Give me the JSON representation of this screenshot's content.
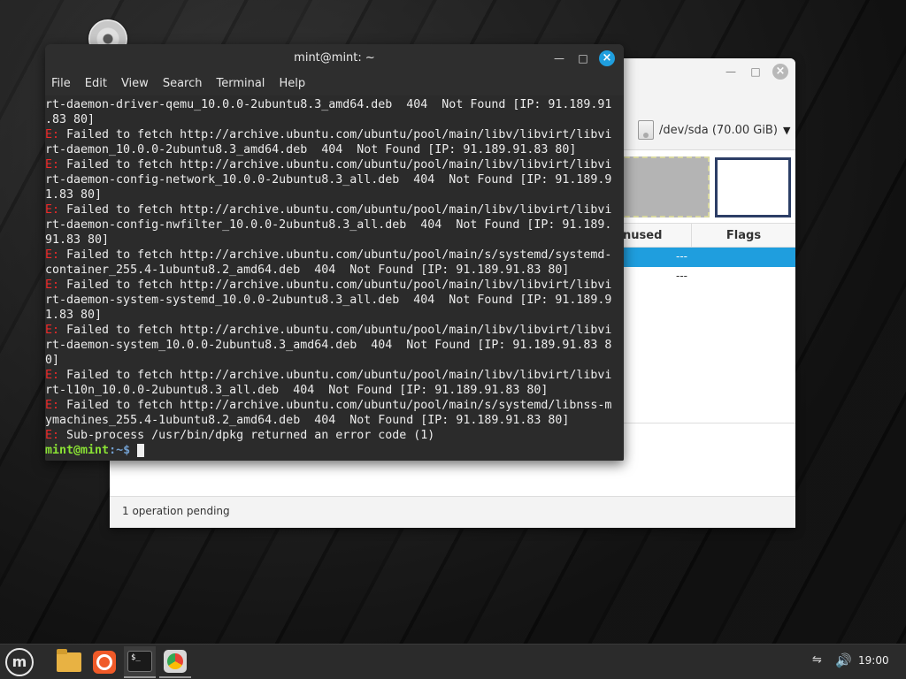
{
  "gparted": {
    "device_label": "/dev/sda (70.00 GiB)",
    "columns": {
      "unused": "nused",
      "flags": "Flags"
    },
    "rows": [
      "---",
      "---"
    ],
    "status": "1 operation pending"
  },
  "terminal": {
    "title": "mint@mint: ~",
    "menu": [
      "File",
      "Edit",
      "View",
      "Search",
      "Terminal",
      "Help"
    ],
    "lines": [
      {
        "type": "plain",
        "text": "rt-daemon-driver-qemu_10.0.0-2ubuntu8.3_amd64.deb  404  Not Found [IP: 91.189.91"
      },
      {
        "type": "plain",
        "text": ".83 80]"
      },
      {
        "type": "err",
        "text": " Failed to fetch http://archive.ubuntu.com/ubuntu/pool/main/libv/libvirt/libvi"
      },
      {
        "type": "plain",
        "text": "rt-daemon_10.0.0-2ubuntu8.3_amd64.deb  404  Not Found [IP: 91.189.91.83 80]"
      },
      {
        "type": "err",
        "text": " Failed to fetch http://archive.ubuntu.com/ubuntu/pool/main/libv/libvirt/libvi"
      },
      {
        "type": "plain",
        "text": "rt-daemon-config-network_10.0.0-2ubuntu8.3_all.deb  404  Not Found [IP: 91.189.9"
      },
      {
        "type": "plain",
        "text": "1.83 80]"
      },
      {
        "type": "err",
        "text": " Failed to fetch http://archive.ubuntu.com/ubuntu/pool/main/libv/libvirt/libvi"
      },
      {
        "type": "plain",
        "text": "rt-daemon-config-nwfilter_10.0.0-2ubuntu8.3_all.deb  404  Not Found [IP: 91.189."
      },
      {
        "type": "plain",
        "text": "91.83 80]"
      },
      {
        "type": "err",
        "text": " Failed to fetch http://archive.ubuntu.com/ubuntu/pool/main/s/systemd/systemd-"
      },
      {
        "type": "plain",
        "text": "container_255.4-1ubuntu8.2_amd64.deb  404  Not Found [IP: 91.189.91.83 80]"
      },
      {
        "type": "err",
        "text": " Failed to fetch http://archive.ubuntu.com/ubuntu/pool/main/libv/libvirt/libvi"
      },
      {
        "type": "plain",
        "text": "rt-daemon-system-systemd_10.0.0-2ubuntu8.3_all.deb  404  Not Found [IP: 91.189.9"
      },
      {
        "type": "plain",
        "text": "1.83 80]"
      },
      {
        "type": "err",
        "text": " Failed to fetch http://archive.ubuntu.com/ubuntu/pool/main/libv/libvirt/libvi"
      },
      {
        "type": "plain",
        "text": "rt-daemon-system_10.0.0-2ubuntu8.3_amd64.deb  404  Not Found [IP: 91.189.91.83 8"
      },
      {
        "type": "plain",
        "text": "0]"
      },
      {
        "type": "err",
        "text": " Failed to fetch http://archive.ubuntu.com/ubuntu/pool/main/libv/libvirt/libvi"
      },
      {
        "type": "plain",
        "text": "rt-l10n_10.0.0-2ubuntu8.3_all.deb  404  Not Found [IP: 91.189.91.83 80]"
      },
      {
        "type": "err",
        "text": " Failed to fetch http://archive.ubuntu.com/ubuntu/pool/main/s/systemd/libnss-m"
      },
      {
        "type": "plain",
        "text": "ymachines_255.4-1ubuntu8.2_amd64.deb  404  Not Found [IP: 91.189.91.83 80]"
      },
      {
        "type": "err",
        "text": " Sub-process /usr/bin/dpkg returned an error code (1)"
      }
    ],
    "err_prefix": "E:",
    "prompt_user": "mint@mint",
    "prompt_path": ":~$ "
  },
  "taskbar": {
    "clock": "19:00"
  }
}
